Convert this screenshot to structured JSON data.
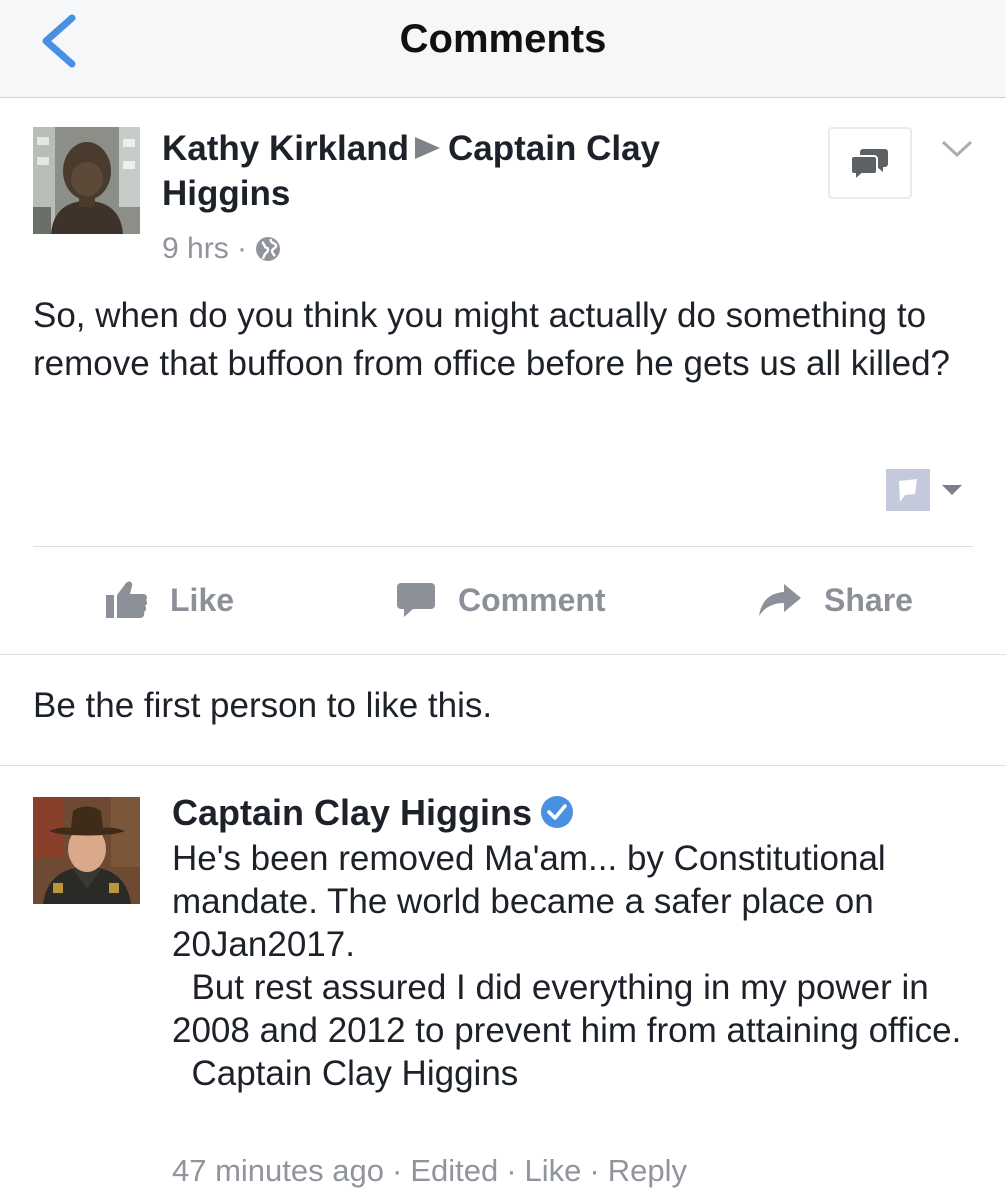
{
  "header": {
    "title": "Comments",
    "back_icon": "chevron-left-icon",
    "accent": "#4a90e2"
  },
  "post": {
    "author": "Kathy Kirkland",
    "target": "Captain Clay Higgins",
    "time": "9 hrs",
    "meta_sep": "·",
    "audience_icon": "globe-icon",
    "text": "So, when do you think you might actually do something to remove that buffoon from office before he gets us all killed?"
  },
  "actions": {
    "like": "Like",
    "comment": "Comment",
    "share": "Share"
  },
  "likes_summary": "Be the first person to like this.",
  "comment": {
    "author": "Captain Clay Higgins",
    "verified_icon": "verified-badge-icon",
    "body": "He's been removed Ma'am... by Constitutional mandate. The world became a safer place on 20Jan2017.\n  But rest assured I did everything in my power in 2008 and 2012 to prevent him from attaining office.\n  Captain Clay Higgins",
    "time": "47 minutes ago",
    "edited": "Edited",
    "like": "Like",
    "reply": "Reply",
    "sep": "·"
  }
}
